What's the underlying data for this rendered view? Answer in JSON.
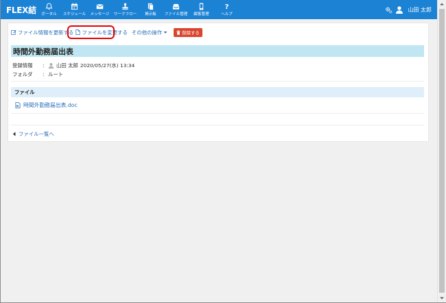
{
  "header": {
    "brand": "FLEX結",
    "nav": [
      {
        "label": "ポータル",
        "icon": "bell-icon"
      },
      {
        "label": "スケジュール",
        "icon": "calendar-icon"
      },
      {
        "label": "メッセージ",
        "icon": "envelope-icon"
      },
      {
        "label": "ワークフロー",
        "icon": "stamp-icon"
      },
      {
        "label": "掲示板",
        "icon": "clipboard-icon"
      },
      {
        "label": "ファイル管理",
        "icon": "inbox-icon"
      },
      {
        "label": "顧客管理",
        "icon": "phone-icon"
      },
      {
        "label": "ヘルプ",
        "icon": "question-icon"
      }
    ],
    "user_name": "山田 太郎"
  },
  "toolbar": {
    "update_info": "ファイル情報を更新する",
    "change_file": "ファイルを変更する",
    "other_actions": "その他の操作",
    "delete": "削除する"
  },
  "document": {
    "title": "時間外勤務届出表",
    "registration_label": "登録情報",
    "registration_user": "山田 太郎",
    "registration_datetime": "2020/05/27(水) 13:34",
    "folder_label": "フォルダ",
    "folder_value": "ルート",
    "colon": ":"
  },
  "files": {
    "header": "ファイル",
    "items": [
      {
        "name": "時間外勤務届出表.doc"
      }
    ]
  },
  "back_link": "ファイル一覧へ",
  "colors": {
    "header_bg": "#1c82d4",
    "title_bg": "#bfe6f2",
    "file_header_bg": "#deeff9",
    "link": "#2a6fb8",
    "delete_bg": "#d9452f",
    "highlight": "#e30000"
  }
}
